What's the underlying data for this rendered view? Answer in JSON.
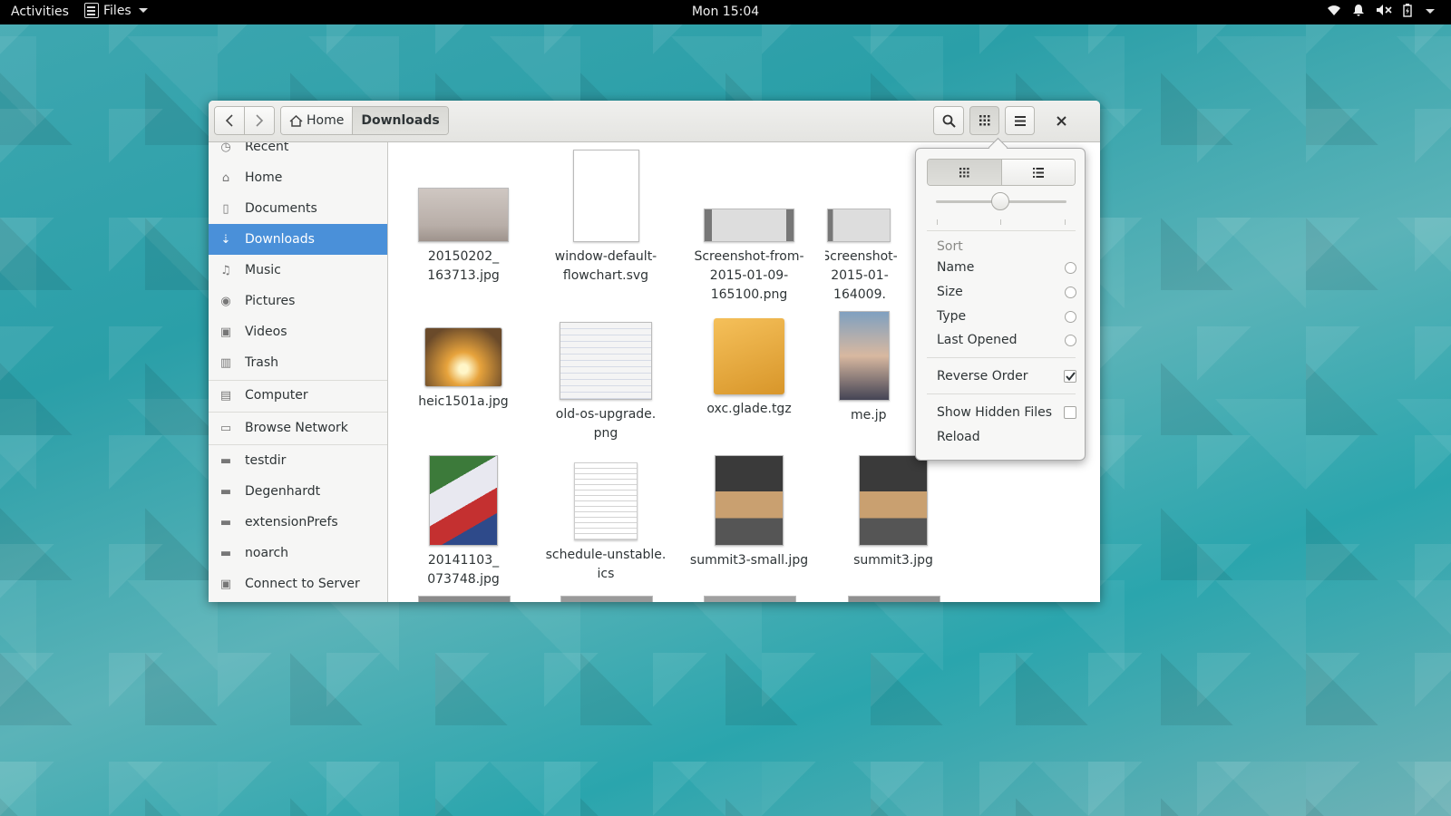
{
  "topbar": {
    "activities": "Activities",
    "app_name": "Files",
    "clock": "Mon 15:04",
    "tray_icons": [
      "wifi-icon",
      "notification-icon",
      "volume-muted-icon",
      "battery-icon",
      "menu-caret-icon"
    ]
  },
  "header": {
    "back_icon": "chevron-left-icon",
    "forward_icon": "chevron-right-icon",
    "path": [
      "Home",
      "Downloads"
    ],
    "search_icon": "search-icon",
    "view_icon": "grid-icon",
    "menu_icon": "hamburger-icon",
    "close_icon": "close-icon"
  },
  "sidebar": {
    "items": [
      {
        "label": "Recent",
        "icon": "clock-icon"
      },
      {
        "label": "Home",
        "icon": "home-icon"
      },
      {
        "label": "Documents",
        "icon": "document-icon"
      },
      {
        "label": "Downloads",
        "icon": "download-icon",
        "selected": true
      },
      {
        "label": "Music",
        "icon": "music-icon"
      },
      {
        "label": "Pictures",
        "icon": "camera-icon"
      },
      {
        "label": "Videos",
        "icon": "video-icon"
      },
      {
        "label": "Trash",
        "icon": "trash-icon"
      },
      {
        "label": "Computer",
        "icon": "computer-icon"
      },
      {
        "label": "Browse Network",
        "icon": "network-icon"
      },
      {
        "label": "testdir",
        "icon": "folder-icon"
      },
      {
        "label": "Degenhardt",
        "icon": "folder-icon"
      },
      {
        "label": "extensionPrefs",
        "icon": "folder-icon"
      },
      {
        "label": "noarch",
        "icon": "folder-icon"
      },
      {
        "label": "Connect to Server",
        "icon": "server-icon"
      }
    ]
  },
  "files": [
    {
      "name": "20150202_\n163713.jpg",
      "kind": "photo-snow"
    },
    {
      "name": "window-default-\nflowchart.svg",
      "kind": "blank-svg"
    },
    {
      "name": "Screenshot-from-\n2015-01-09-\n165100.png",
      "kind": "screenshot"
    },
    {
      "name": "Screenshot-\n2015-01-\n164009.",
      "kind": "screenshot"
    },
    {
      "name": "heic1501a.jpg",
      "kind": "photo-tree"
    },
    {
      "name": "old-os-upgrade.\npng",
      "kind": "dialog"
    },
    {
      "name": "oxc.glade.tgz",
      "kind": "archive"
    },
    {
      "name": "me.jp",
      "kind": "photo-face"
    },
    {
      "name": "20141103_\n073748.jpg",
      "kind": "photo-glove"
    },
    {
      "name": "schedule-unstable.\nics",
      "kind": "text-doc"
    },
    {
      "name": "summit3-small.jpg",
      "kind": "photo-room"
    },
    {
      "name": "summit3.jpg",
      "kind": "photo-room"
    }
  ],
  "popover": {
    "grid_icon": "grid-icon",
    "list_icon": "list-icon",
    "zoom_level": 0.5,
    "sort_heading": "Sort",
    "sort_options": [
      {
        "label": "Name",
        "checked": false
      },
      {
        "label": "Size",
        "checked": false
      },
      {
        "label": "Type",
        "checked": false
      },
      {
        "label": "Last Opened",
        "checked": false
      }
    ],
    "reverse_order": {
      "label": "Reverse Order",
      "checked": true
    },
    "show_hidden": {
      "label": "Show Hidden Files",
      "checked": false
    },
    "reload": "Reload"
  },
  "colors": {
    "selection": "#4a90d9",
    "topbar": "#000000",
    "wallpaper": "#2a9fa8"
  }
}
